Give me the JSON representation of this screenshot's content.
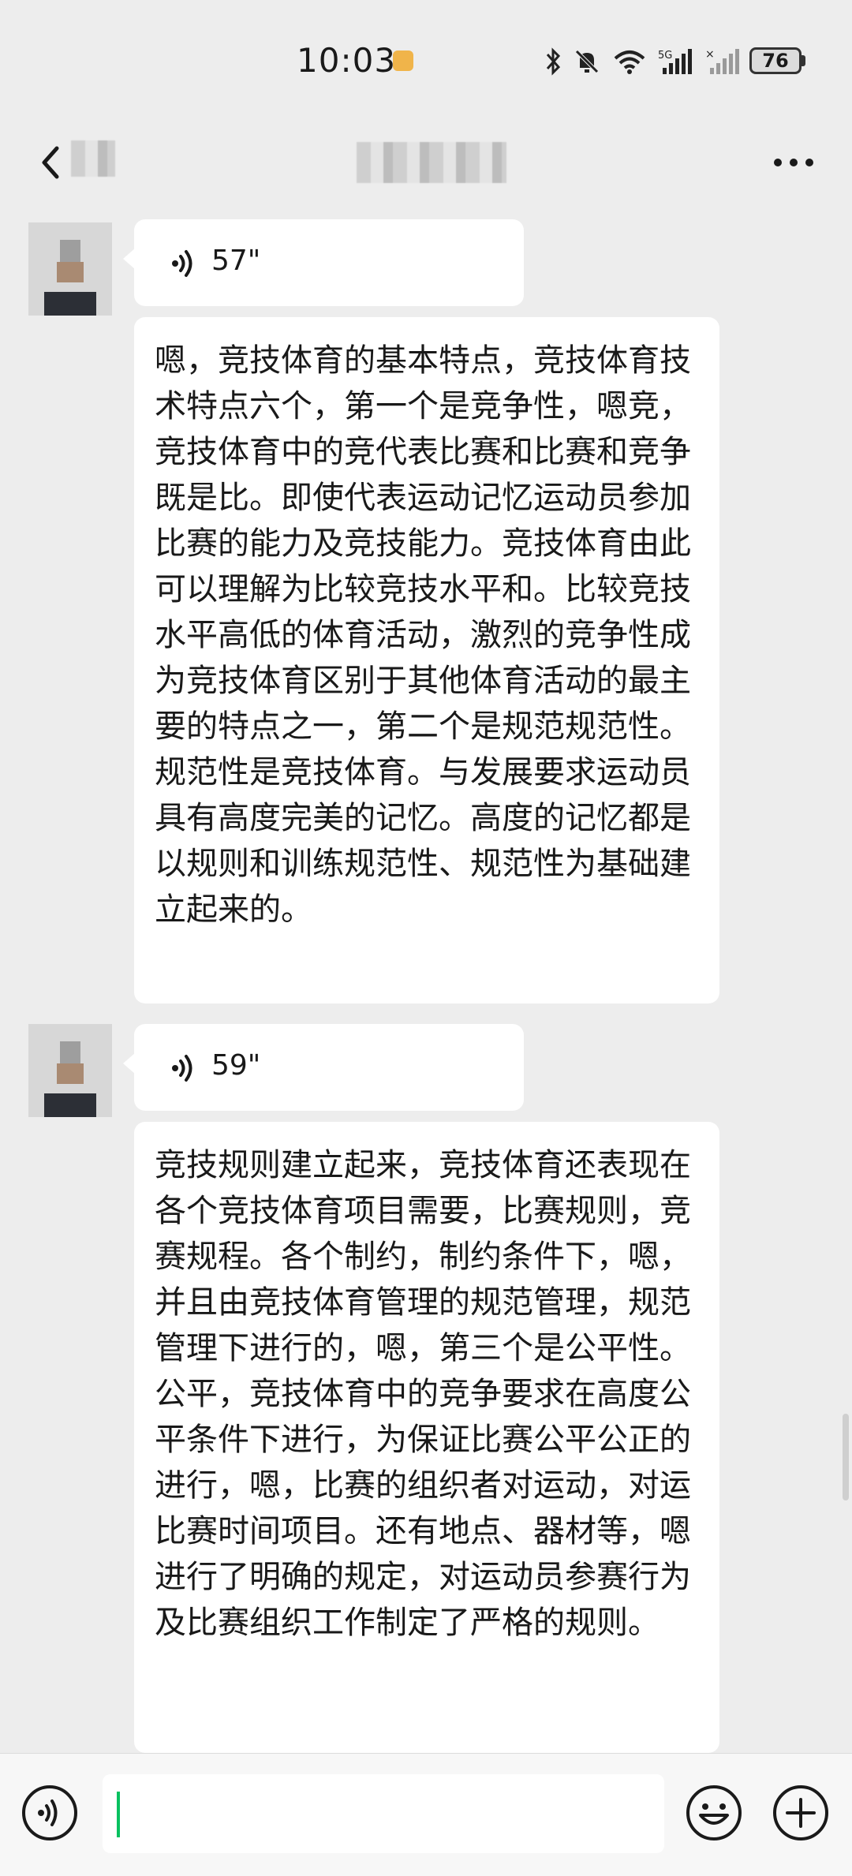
{
  "status_bar": {
    "time": "10:03",
    "battery": "76",
    "icons": [
      "bluetooth-icon",
      "mute-bell-icon",
      "wifi-icon",
      "signal-5g-icon",
      "signal-icon"
    ]
  },
  "header": {
    "title_redacted": true,
    "back_icon": "chevron-left-icon",
    "more_icon": "more-dots-icon"
  },
  "messages": [
    {
      "type": "voice",
      "duration": "57\"",
      "transcript": "嗯，竞技体育的基本特点，竞技体育技术特点六个，第一个是竞争性，嗯竞，竞技体育中的竞代表比赛和比赛和竞争既是比。即使代表运动记忆运动员参加比赛的能力及竞技能力。竞技体育由此可以理解为比较竞技水平和。比较竞技水平高低的体育活动，激烈的竞争性成为竞技体育区别于其他体育活动的最主要的特点之一，第二个是规范规范性。规范性是竞技体育。与发展要求运动员具有高度完美的记忆。高度的记忆都是以规则和训练规范性、规范性为基础建立起来的。"
    },
    {
      "type": "voice",
      "duration": "59\"",
      "transcript": "竞技规则建立起来，竞技体育还表现在各个竞技体育项目需要，比赛规则，竞赛规程。各个制约，制约条件下，嗯，并且由竞技体育管理的规范管理，规范管理下进行的，嗯，第三个是公平性。公平，竞技体育中的竞争要求在高度公平条件下进行，为保证比赛公平公正的进行，嗯，比赛的组织者对运动，对运比赛时间项目。还有地点、器材等，嗯进行了明确的规定，对运动员参赛行为及比赛组织工作制定了严格的规则。"
    }
  ],
  "input_bar": {
    "value": "",
    "voice_icon": "voice-input-icon",
    "emoji_icon": "emoji-icon",
    "plus_icon": "plus-icon"
  },
  "colors": {
    "background": "#ededed",
    "bubble": "#ffffff",
    "cursor": "#07c160"
  }
}
